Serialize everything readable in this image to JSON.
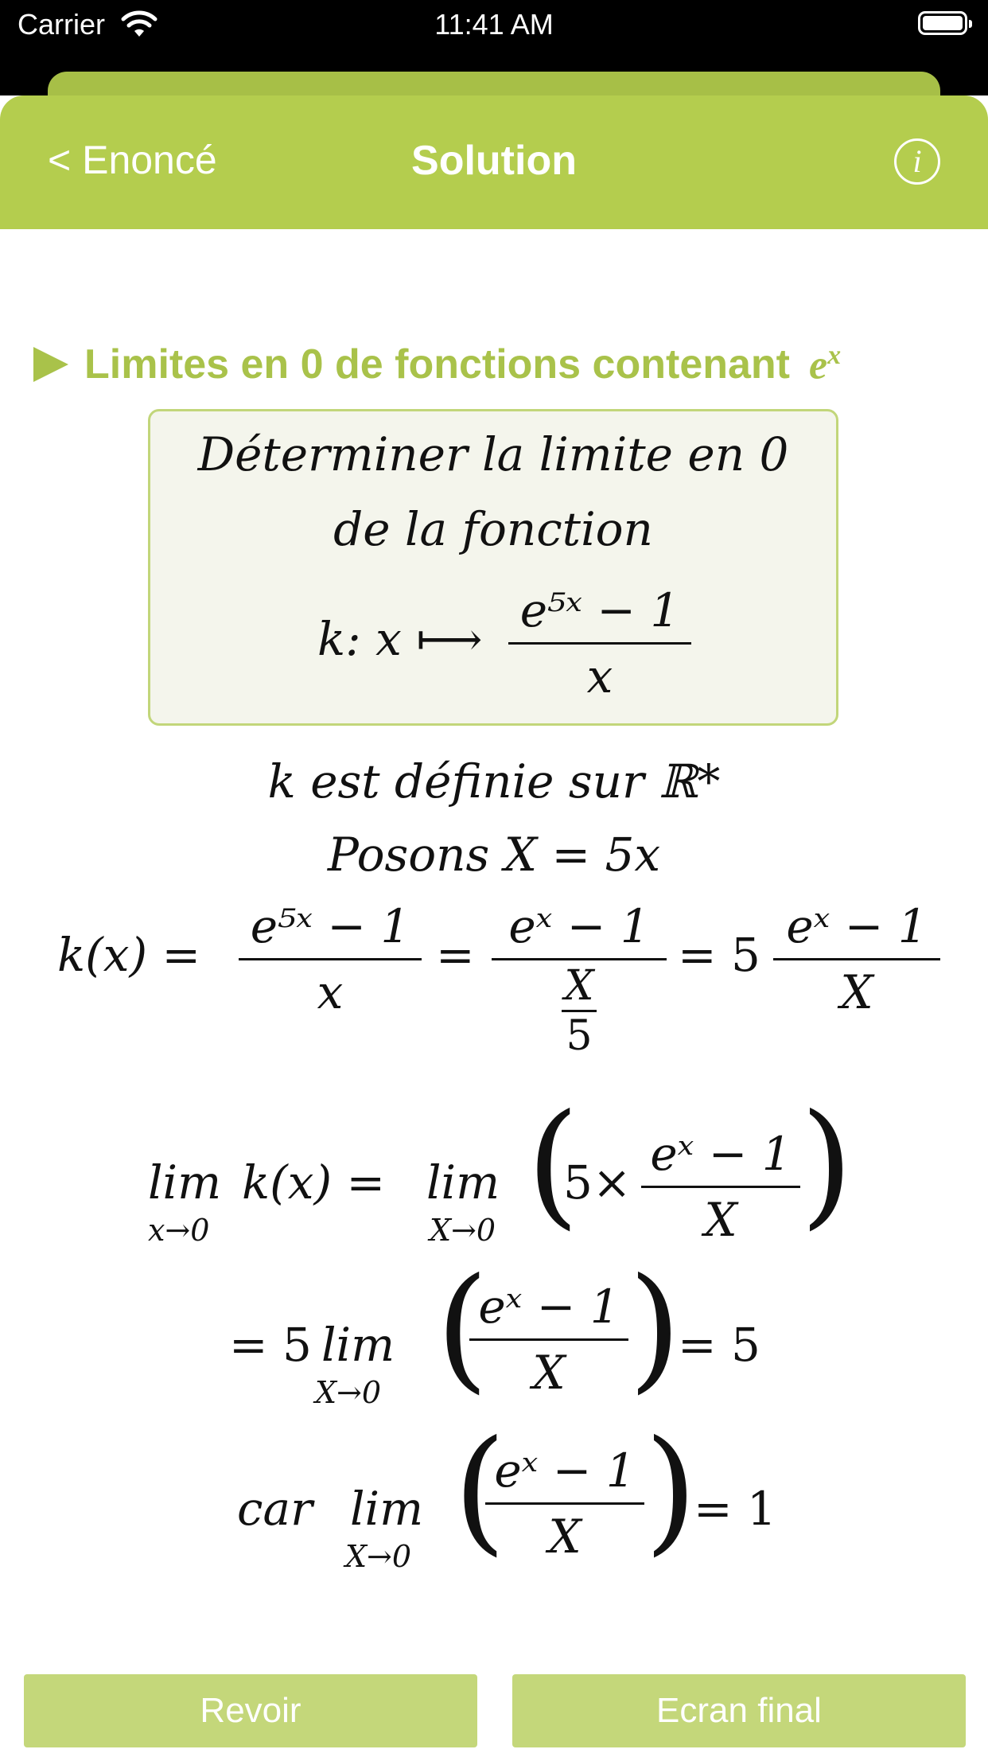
{
  "status_bar": {
    "carrier": "Carrier",
    "time": "11:41 AM"
  },
  "nav": {
    "back_label": "< Enoncé",
    "title": "Solution",
    "info_label": "i"
  },
  "section": {
    "title": "Limites en 0 de fonctions contenant",
    "title_math_base": "e",
    "title_math_exp": "x"
  },
  "problem": {
    "line1": "Déterminer la limite en 0",
    "line2": "de la fonction",
    "lhs": "k: x ⟼",
    "num": "e⁵ˣ − 1",
    "den": "x"
  },
  "solution": {
    "line1": "k est définie sur ℝ*",
    "line2": "Posons X = 5x",
    "eq1_lhs": "k(x) =",
    "eq1_f1_num": "e⁵ˣ − 1",
    "eq1_f1_den": "x",
    "eq1_eq2": "=",
    "eq1_f2_num": "eˣ − 1",
    "eq1_f2_den_num": "X",
    "eq1_f2_den_den": "5",
    "eq1_eq3": "= 5",
    "eq1_f3_num": "eˣ − 1",
    "eq1_f3_den": "X",
    "lim": "lim",
    "lim_sub_lower": "x→0",
    "lim_sub_upper": "X→0",
    "eq2_mid": "k(x) =",
    "eq2_five_times": "5×",
    "frac_num": "eˣ − 1",
    "frac_den": "X",
    "eq3_lhs": "= 5",
    "eq3_rhs": "= 5",
    "eq4_car": "car",
    "eq4_rhs": "= 1"
  },
  "buttons": {
    "revoir": "Revoir",
    "ecran_final": "Ecran final"
  },
  "colors": {
    "nav_green": "#b4cd4e",
    "button_green": "#c4d77a",
    "title_green": "#a9c24a",
    "box_bg": "#f4f5ec"
  }
}
